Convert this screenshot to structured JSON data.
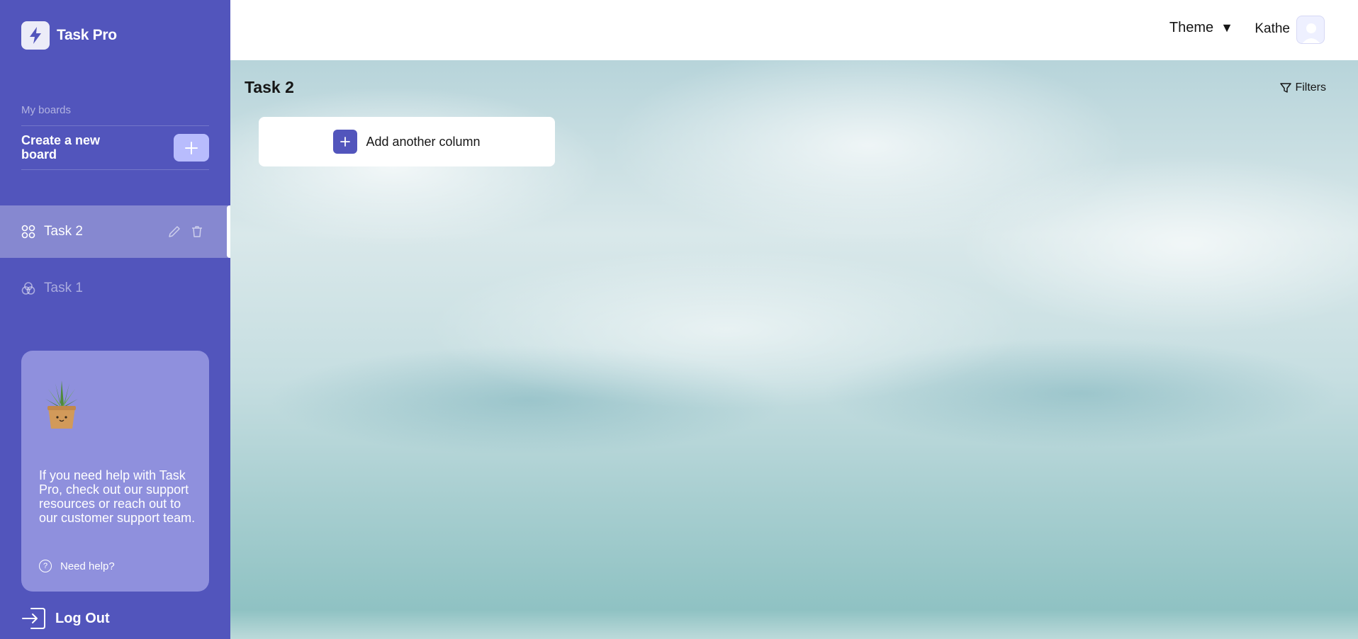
{
  "app": {
    "name": "Task Pro"
  },
  "sidebar": {
    "section_label": "My boards",
    "create_label": "Create a new board",
    "boards": [
      {
        "label": "Task 2",
        "active": true
      },
      {
        "label": "Task 1",
        "active": false
      }
    ],
    "help": {
      "text": "If you need help with Task Pro, check out our support resources or reach out to our customer support team.",
      "link_label": "Need help?"
    },
    "logout_label": "Log Out"
  },
  "header": {
    "theme_label": "Theme",
    "theme_caret": "▼",
    "username": "Kathe"
  },
  "main": {
    "board_title": "Task 2",
    "filters_label": "Filters",
    "add_column_label": "Add another column"
  },
  "colors": {
    "sidebar": "#5255bc",
    "accent": "#5255bc",
    "create_button": "#b8bcfd",
    "help_card": "#8f90dd"
  },
  "icons": {
    "logo": "lightning-icon",
    "create": "plus-icon",
    "active_board": "grid-icon",
    "inactive_board": "circles-icon",
    "edit": "pencil-icon",
    "delete": "trash-icon",
    "help": "question-icon",
    "logout": "logout-icon",
    "filters": "funnel-icon",
    "add_column": "plus-icon"
  }
}
